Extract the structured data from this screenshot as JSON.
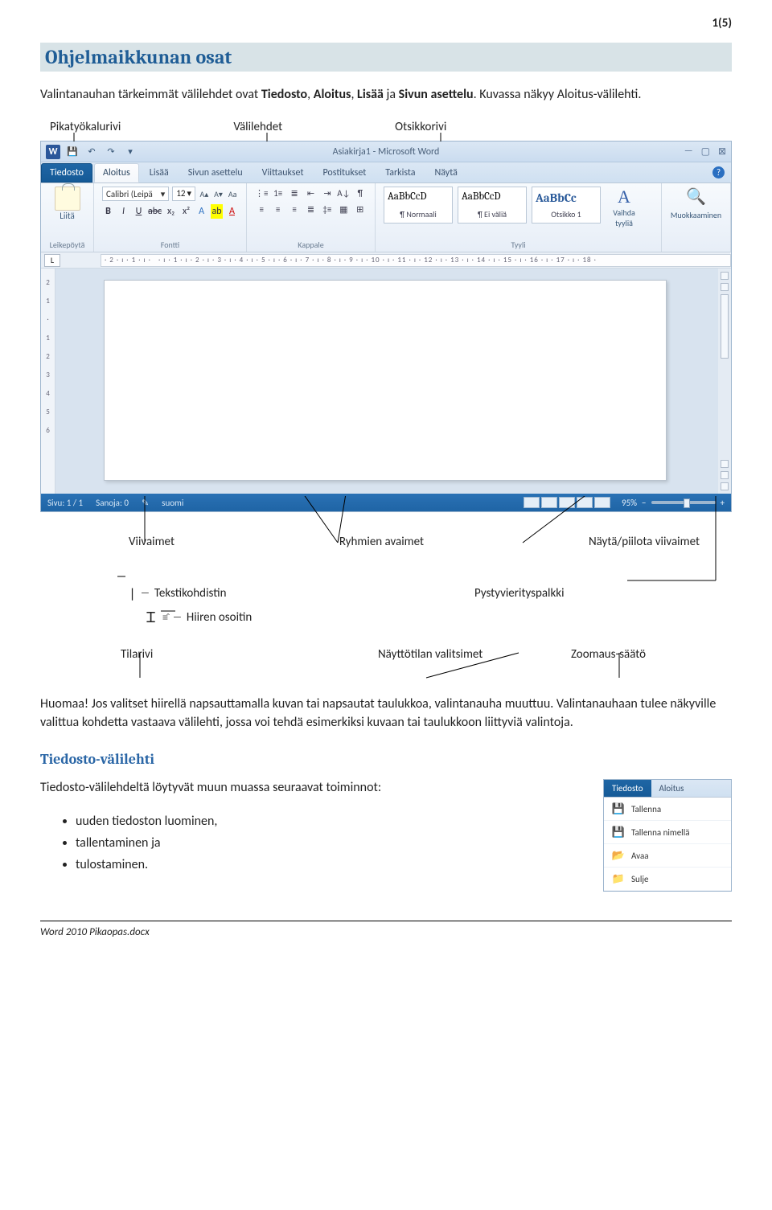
{
  "page_number": "1(5)",
  "heading": "Ohjelmaikkunan osat",
  "intro_before_bold1": "Valintanauhan tärkeimmät välilehdet ovat ",
  "intro_bold1": "Tiedosto",
  "intro_sep1": ", ",
  "intro_bold2": "Aloitus",
  "intro_sep2": ", ",
  "intro_bold3": "Lisää",
  "intro_sep3": " ja ",
  "intro_bold4": "Sivun asettelu",
  "intro_after": ". Kuvassa näkyy Aloitus-välilehti.",
  "callouts": {
    "pikatyokalurivi": "Pikatyökalurivi",
    "valilehdet": "Välilehdet",
    "otsikkorivi": "Otsikkorivi",
    "viivaimet": "Viivaimet",
    "ryhmien_avaimet": "Ryhmien avaimet",
    "nayta_piilota": "Näytä/piilota viivaimet",
    "tekstikohdistin": "Tekstikohdistin",
    "hiiren_osoitin": "Hiiren osoitin",
    "pystyvierityspalkki": "Pystyvierityspalkki",
    "tilarivi": "Tilarivi",
    "nayttotilan_valitsimet": "Näyttötilan valitsimet",
    "zoomaus": "Zoomaus-säätö"
  },
  "word": {
    "title": "Asiakirja1 - Microsoft Word",
    "tabs": [
      "Tiedosto",
      "Aloitus",
      "Lisää",
      "Sivun asettelu",
      "Viittaukset",
      "Postitukset",
      "Tarkista",
      "Näytä"
    ],
    "clip_label_btn": "Liitä",
    "clip_group": "Leikepöytä",
    "font_name": "Calibri (Leipä",
    "font_size": "12",
    "font_group": "Fontti",
    "para_group": "Kappale",
    "style1_sample": "AaBbCcD",
    "style1_name": "¶ Normaali",
    "style2_sample": "AaBbCcD",
    "style2_name": "¶ Ei väliä",
    "style3_sample": "AaBbCc",
    "style3_name": "Otsikko 1",
    "change_style": "Vaihda tyyliä",
    "styles_group": "Tyyli",
    "editing": "Muokkaaminen",
    "ruler_L": "L",
    "status_page": "Sivu: 1 / 1",
    "status_words": "Sanoja: 0",
    "status_lang": "suomi",
    "zoom": "95%"
  },
  "para_huomaa": "Huomaa! Jos valitset hiirellä napsauttamalla kuvan tai napsautat taulukkoa, valintanauha muuttuu. Valintanauhaan tulee näkyville valittua kohdetta vastaava välilehti, jossa voi tehdä esimerkiksi kuvaan tai taulukkoon liittyviä valintoja.",
  "h2_tiedosto": "Tiedosto-välilehti",
  "para_tiedosto": "Tiedosto-välilehdeltä löytyvät muun muassa seuraavat toiminnot:",
  "menu_items": {
    "file": "Tiedosto",
    "aloitus": "Aloitus",
    "save": "Tallenna",
    "saveas": "Tallenna nimellä",
    "open": "Avaa",
    "close": "Sulje"
  },
  "bullets": [
    "uuden tiedoston luominen,",
    "tallentaminen ja",
    "tulostaminen."
  ],
  "footer": "Word 2010 Pikaopas.docx"
}
